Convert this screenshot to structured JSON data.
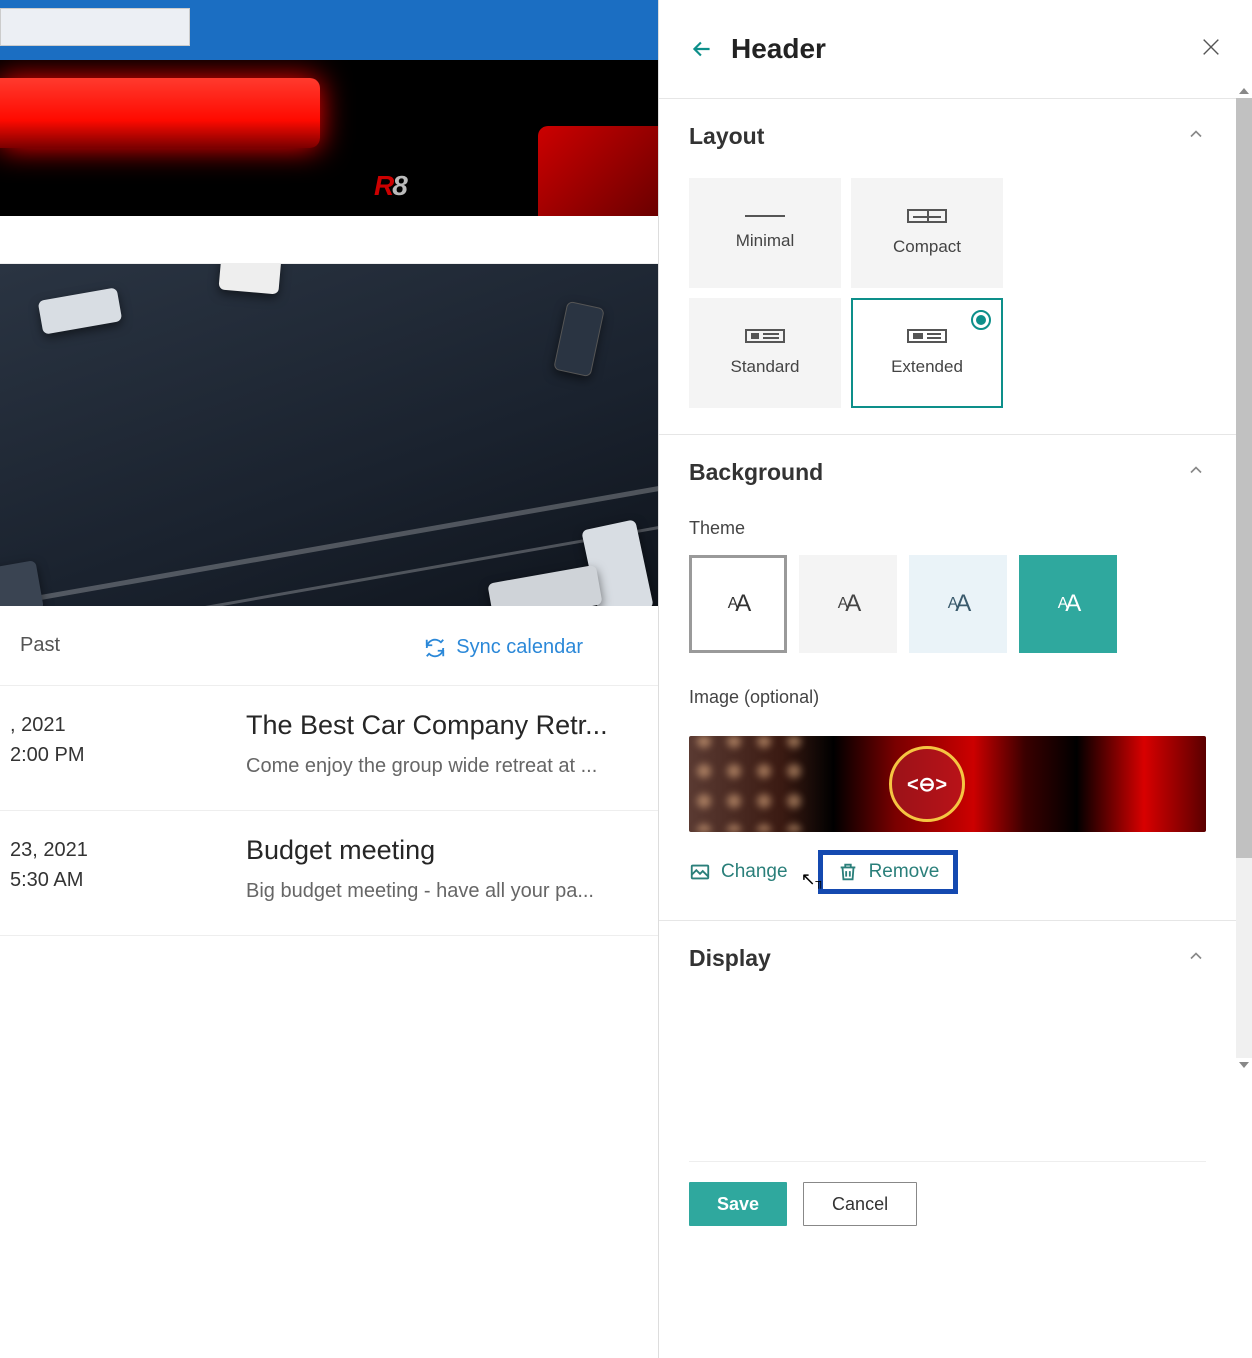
{
  "panel": {
    "title": "Header",
    "sections": {
      "layout": {
        "title": "Layout",
        "options": [
          "Minimal",
          "Compact",
          "Standard",
          "Extended"
        ],
        "selected": "Extended"
      },
      "background": {
        "title": "Background",
        "theme_label": "Theme",
        "image_label": "Image (optional)",
        "change": "Change",
        "remove": "Remove"
      },
      "display": {
        "title": "Display"
      }
    },
    "save": "Save",
    "cancel": "Cancel"
  },
  "main": {
    "badge": "R8",
    "tab_past": "Past",
    "sync": "Sync calendar",
    "events": [
      {
        "date": ", 2021",
        "time": "2:00 PM",
        "title": "The Best Car Company Retr...",
        "desc": "Come enjoy the group wide retreat at ..."
      },
      {
        "date": "23, 2021",
        "time": "5:30 AM",
        "title": "Budget meeting",
        "desc": "Big budget meeting - have all your pa..."
      }
    ]
  }
}
